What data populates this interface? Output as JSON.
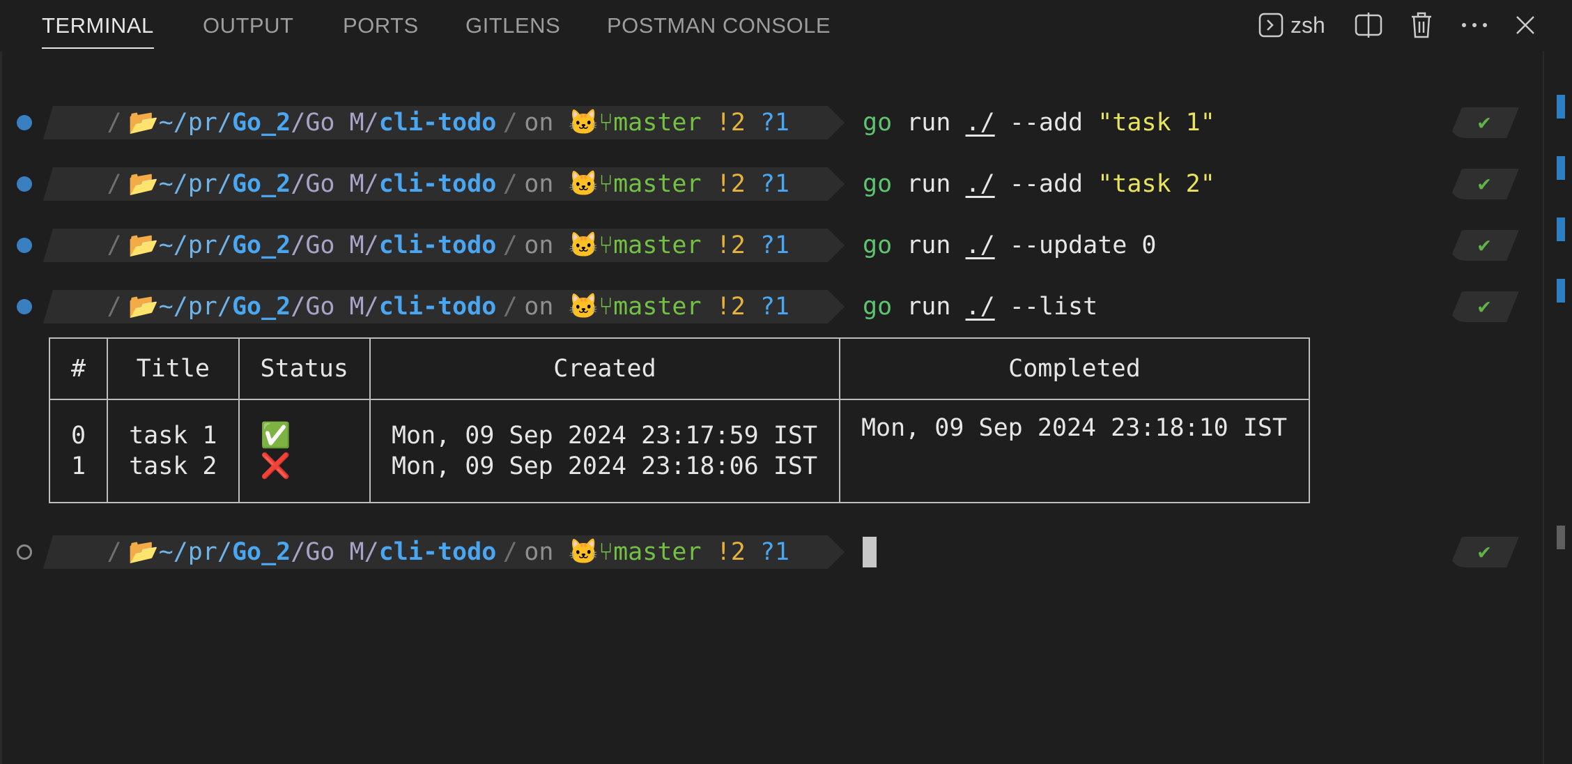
{
  "tabs": [
    {
      "label": "TERMINAL",
      "active": true
    },
    {
      "label": "OUTPUT"
    },
    {
      "label": "PORTS"
    },
    {
      "label": "GITLENS"
    },
    {
      "label": "POSTMAN CONSOLE"
    }
  ],
  "actions": {
    "shell_label": "zsh",
    "icons": [
      "terminal-icon",
      "split-icon",
      "trash-icon",
      "more-icon",
      "close-icon"
    ]
  },
  "prompt": {
    "apple": "",
    "sep": "/",
    "folder": "📂",
    "path_a": "~/pr/",
    "path_b": "Go_2",
    "path_c": "/Go M/",
    "path_d": "cli-todo",
    "on": "on",
    "git_icon": "🐱",
    "branch_icon": "⑂",
    "branch": "master",
    "modified": "!2",
    "untracked": "?1",
    "check": "✔"
  },
  "commands": [
    {
      "go": "go",
      "run": "run",
      "path": "./",
      "flag": "--add",
      "arg": "\"task 1\""
    },
    {
      "go": "go",
      "run": "run",
      "path": "./",
      "flag": "--add",
      "arg": "\"task 2\""
    },
    {
      "go": "go",
      "run": "run",
      "path": "./",
      "flag": "--update 0",
      "arg": ""
    },
    {
      "go": "go",
      "run": "run",
      "path": "./",
      "flag": "--list",
      "arg": ""
    }
  ],
  "table": {
    "headers": [
      "#",
      "Title",
      "Status",
      "Created",
      "Completed"
    ],
    "rows": [
      {
        "id": "0",
        "title": "task 1",
        "status": "✅",
        "created": "Mon, 09 Sep 2024 23:17:59 IST",
        "completed": "Mon, 09 Sep 2024 23:18:10 IST"
      },
      {
        "id": "1",
        "title": "task 2",
        "status": "❌",
        "created": "Mon, 09 Sep 2024 23:18:06 IST",
        "completed": ""
      }
    ]
  },
  "colors": {
    "background": "#1e1e1e",
    "accent_blue": "#4aa6f0",
    "git_green": "#74c043",
    "string_yellow": "#e8e45c"
  }
}
